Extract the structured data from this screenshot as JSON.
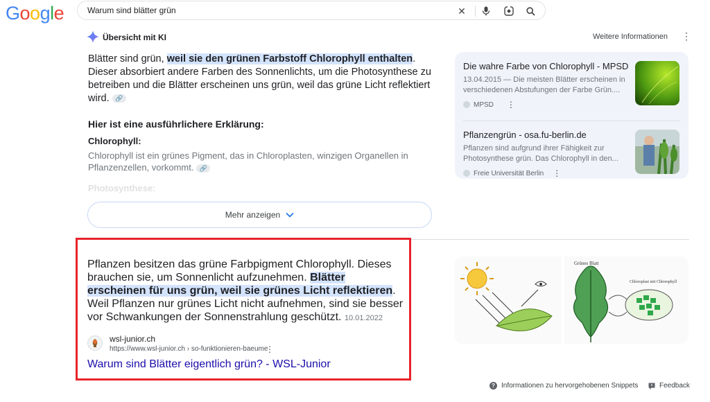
{
  "header": {
    "logo_letters": [
      "G",
      "o",
      "o",
      "g",
      "l",
      "e"
    ],
    "search_value": "Warum sind blätter grün",
    "icons": [
      "close-icon",
      "mic-icon",
      "lens-icon",
      "search-icon"
    ]
  },
  "ai_overview": {
    "title": "Übersicht mit KI",
    "more_info": "Weitere Informationen",
    "para_before": "Blätter sind grün, ",
    "para_highlight": "weil sie den grünen Farbstoff Chlorophyll enthalten",
    "para_after": ". Dieser absorbiert andere Farben des Sonnenlichts, um die Photosynthese zu betreiben und die Blätter erscheinen uns grün, weil das grüne Licht reflektiert wird.",
    "subheading": "Hier ist eine ausführlichere Erklärung:",
    "chlorophyll_heading": "Chlorophyll:",
    "chlorophyll_text": "Chlorophyll ist ein grünes Pigment, das in Chloroplasten, winzigen Organellen in Pflanzenzellen, vorkommt.",
    "photosynthese_heading": "Photosynthese:",
    "show_more": "Mehr anzeigen"
  },
  "side_panel": [
    {
      "title": "Die wahre Farbe von Chlorophyll - MPSD",
      "snippet": "13.04.2015 — Die meisten Blätter erscheinen in verschiedenen Abstufungen der Farbe Grün....",
      "source": "MPSD"
    },
    {
      "title": "Pflanzengrün - osa.fu-berlin.de",
      "snippet": "Pflanzen sind aufgrund ihrer Fähigkeit zur Photosynthese grün. Das Chlorophyll in den...",
      "source": "Freie Universität Berlin"
    }
  ],
  "featured_snippet": {
    "text_before": "Pflanzen besitzen das grüne Farbpigment Chlorophyll. Dieses brauchen sie, um Sonnenlicht aufzunehmen. ",
    "text_highlight": "Blätter erscheinen für uns grün, weil sie grünes Licht reflektieren",
    "text_after": ". Weil Pflanzen nur grünes Licht nicht aufnehmen, sind sie besser vor Schwankungen der Sonnenstrahlung geschützt.",
    "date": "10.01.2022",
    "site_name": "wsl-junior.ch",
    "url": "https://www.wsl-junior.ch › so-funktionieren-baeume",
    "link_title": "Warum sind Blätter eigentlich grün? - WSL-Junior",
    "image_labels": [
      "Grünes Blatt",
      "Chloroplast mit Chlorophyll"
    ]
  },
  "footer": {
    "info": "Informationen zu hervorgehobenen Snippets",
    "feedback": "Feedback"
  },
  "colors": {
    "highlight": "#d3e3fd",
    "link": "#1a0dab",
    "annotation_box": "#e8232b"
  }
}
